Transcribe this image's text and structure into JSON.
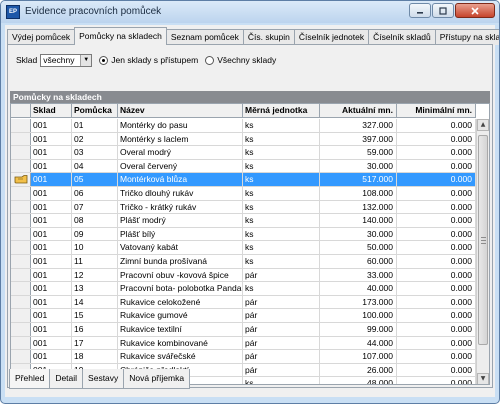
{
  "window": {
    "title": "Evidence pracovních pomůcek",
    "icon": "app-icon",
    "icon_text": "EP"
  },
  "tabs": [
    {
      "label": "Výdej pomůcek",
      "active": false
    },
    {
      "label": "Pomůcky na skladech",
      "active": true
    },
    {
      "label": "Seznam pomůcek",
      "active": false
    },
    {
      "label": "Čís. skupin",
      "active": false
    },
    {
      "label": "Číselník jednotek",
      "active": false
    },
    {
      "label": "Číselník skladů",
      "active": false
    },
    {
      "label": "Přístupy na sklady",
      "active": false
    }
  ],
  "filter": {
    "label": "Sklad",
    "selected": "všechny",
    "radio_only_access": "Jen sklady s přístupem",
    "radio_all": "Všechny sklady",
    "radio_selected": "only_access"
  },
  "section_title": "Pomůcky na skladech",
  "table": {
    "columns": [
      "Sklad",
      "Pomůcka",
      "Název",
      "Měrná jednotka",
      "Aktuální mn.",
      "Minimální mn."
    ],
    "selected_index": 4,
    "rows": [
      [
        "001",
        "01",
        "Montérky do pasu",
        "ks",
        "327.000",
        "0.000"
      ],
      [
        "001",
        "02",
        "Montérky s laclem",
        "ks",
        "397.000",
        "0.000"
      ],
      [
        "001",
        "03",
        "Overal modrý",
        "ks",
        "59.000",
        "0.000"
      ],
      [
        "001",
        "04",
        "Overal červený",
        "ks",
        "30.000",
        "0.000"
      ],
      [
        "001",
        "05",
        "Montérková blůza",
        "ks",
        "517.000",
        "0.000"
      ],
      [
        "001",
        "06",
        "Tričko dlouhý rukáv",
        "ks",
        "108.000",
        "0.000"
      ],
      [
        "001",
        "07",
        "Tričko - krátký rukáv",
        "ks",
        "132.000",
        "0.000"
      ],
      [
        "001",
        "08",
        "Plášť modrý",
        "ks",
        "140.000",
        "0.000"
      ],
      [
        "001",
        "09",
        "Plášť bílý",
        "ks",
        "30.000",
        "0.000"
      ],
      [
        "001",
        "10",
        "Vatovaný kabát",
        "ks",
        "50.000",
        "0.000"
      ],
      [
        "001",
        "11",
        "Zimní bunda prošívaná",
        "ks",
        "60.000",
        "0.000"
      ],
      [
        "001",
        "12",
        "Pracovní obuv -kovová špice",
        "pár",
        "33.000",
        "0.000"
      ],
      [
        "001",
        "13",
        "Pracovní bota- polobotka Panda",
        "ks",
        "40.000",
        "0.000"
      ],
      [
        "001",
        "14",
        "Rukavice celokožené",
        "pár",
        "173.000",
        "0.000"
      ],
      [
        "001",
        "15",
        "Rukavice gumové",
        "pár",
        "100.000",
        "0.000"
      ],
      [
        "001",
        "16",
        "Rukavice textilní",
        "pár",
        "99.000",
        "0.000"
      ],
      [
        "001",
        "17",
        "Rukavice kombinované",
        "pár",
        "44.000",
        "0.000"
      ],
      [
        "001",
        "18",
        "Rukavice svářečské",
        "pár",
        "107.000",
        "0.000"
      ],
      [
        "001",
        "19",
        "Chrániče předloktí",
        "pár",
        "26.000",
        "0.000"
      ],
      [
        "001",
        "20",
        "Svářečská zástěra",
        "ks",
        "48.000",
        "0.000"
      ]
    ]
  },
  "bottom_tabs": [
    {
      "label": "Přehled",
      "active": true
    },
    {
      "label": "Detail",
      "active": false
    },
    {
      "label": "Sestavy",
      "active": false
    },
    {
      "label": "Nová příjemka",
      "active": false
    }
  ],
  "colors": {
    "selection": "#3399ff",
    "section_header": "#888b90"
  }
}
